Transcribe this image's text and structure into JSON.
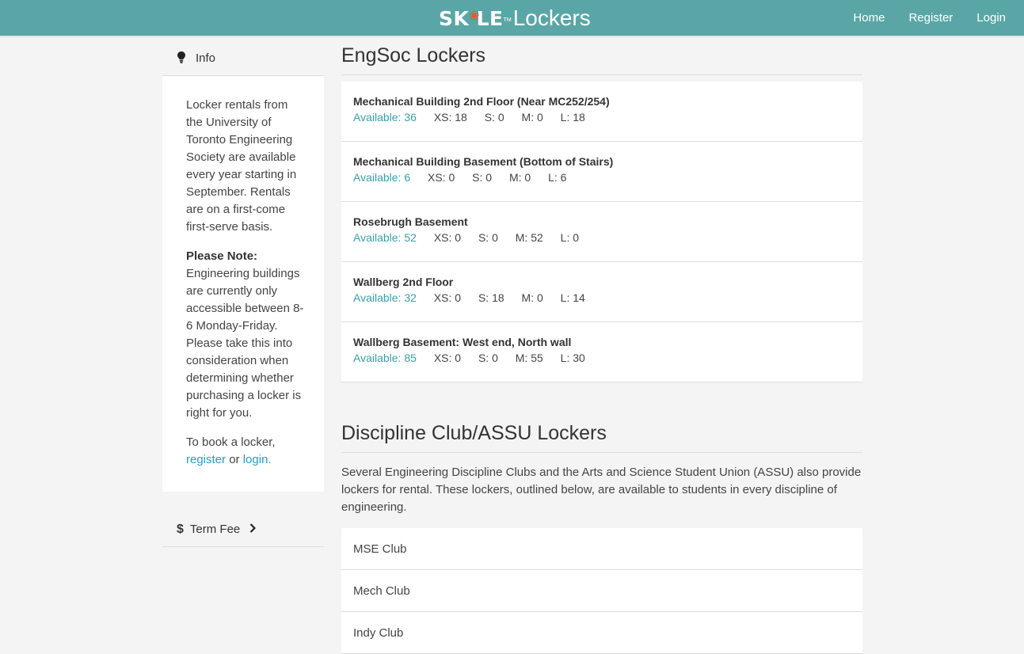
{
  "brand": {
    "skule": "SK LE",
    "tm": "TM",
    "lockers": "Lockers"
  },
  "nav": [
    "Home",
    "Register",
    "Login"
  ],
  "sidebar": {
    "info_label": "Info",
    "intro": "Locker rentals from the University of Toronto Engineering Society are available every year starting in September. Rentals are on a first-come first-serve basis.",
    "note_label": "Please Note:",
    "note": "Engineering buildings are currently only accessible between 8-6 Monday-Friday. Please take this into consideration when determining whether purchasing a locker is right for you.",
    "book_prefix": "To book a locker,",
    "register_link": "register",
    "or": "or",
    "login_link": "login",
    "period": ".",
    "term_fee_label": "Term Fee"
  },
  "engsoc": {
    "title": "EngSoc Lockers",
    "locations": [
      {
        "name": "Mechanical Building 2nd Floor (Near MC252/254)",
        "available": "Available: 36",
        "xs": "XS: 18",
        "s": "S: 0",
        "m": "M: 0",
        "l": "L: 18"
      },
      {
        "name": "Mechanical Building Basement (Bottom of Stairs)",
        "available": "Available: 6",
        "xs": "XS: 0",
        "s": "S: 0",
        "m": "M: 0",
        "l": "L: 6"
      },
      {
        "name": "Rosebrugh Basement",
        "available": "Available: 52",
        "xs": "XS: 0",
        "s": "S: 0",
        "m": "M: 52",
        "l": "L: 0"
      },
      {
        "name": "Wallberg 2nd Floor",
        "available": "Available: 32",
        "xs": "XS: 0",
        "s": "S: 18",
        "m": "M: 0",
        "l": "L: 14"
      },
      {
        "name": "Wallberg Basement: West end, North wall",
        "available": "Available: 85",
        "xs": "XS: 0",
        "s": "S: 0",
        "m": "M: 55",
        "l": "L: 30"
      }
    ]
  },
  "discipline": {
    "title": "Discipline Club/ASSU Lockers",
    "description": "Several Engineering Discipline Clubs and the Arts and Science Student Union (ASSU) also provide lockers for rental. These lockers, outlined below, are available to students in every discipline of engineering.",
    "clubs": [
      "MSE Club",
      "Mech Club",
      "Indy Club"
    ]
  },
  "colors": {
    "header": "#5aa6a6",
    "accent": "#3aa0a8",
    "link": "#2a9bc4"
  }
}
